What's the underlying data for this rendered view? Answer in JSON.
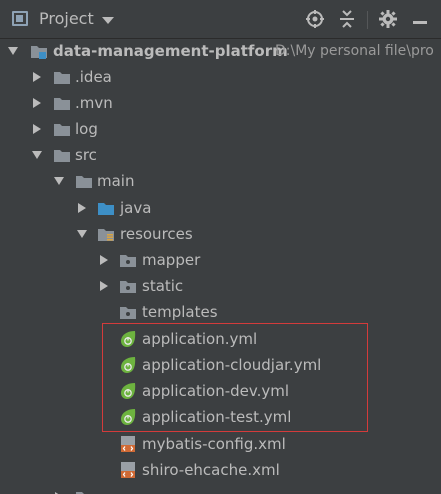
{
  "header": {
    "title": "Project"
  },
  "tree": {
    "root": {
      "label": "data-management-platform",
      "path": "D:\\My personal file\\pro"
    },
    "items": [
      {
        "label": ".idea"
      },
      {
        "label": ".mvn"
      },
      {
        "label": "log"
      },
      {
        "label": "src"
      },
      {
        "label": "main"
      },
      {
        "label": "java"
      },
      {
        "label": "resources"
      },
      {
        "label": "mapper"
      },
      {
        "label": "static"
      },
      {
        "label": "templates"
      },
      {
        "label": "application.yml"
      },
      {
        "label": "application-cloudjar.yml"
      },
      {
        "label": "application-dev.yml"
      },
      {
        "label": "application-test.yml"
      },
      {
        "label": "mybatis-config.xml"
      },
      {
        "label": "shiro-ehcache.xml"
      }
    ]
  },
  "colors": {
    "background": "#3c3f41",
    "folder": "#8a9198",
    "source_folder": "#3d8fc6",
    "spring_leaf": "#6db33f",
    "xml_icon": "#d06a35",
    "highlight": "#d33b3b"
  }
}
